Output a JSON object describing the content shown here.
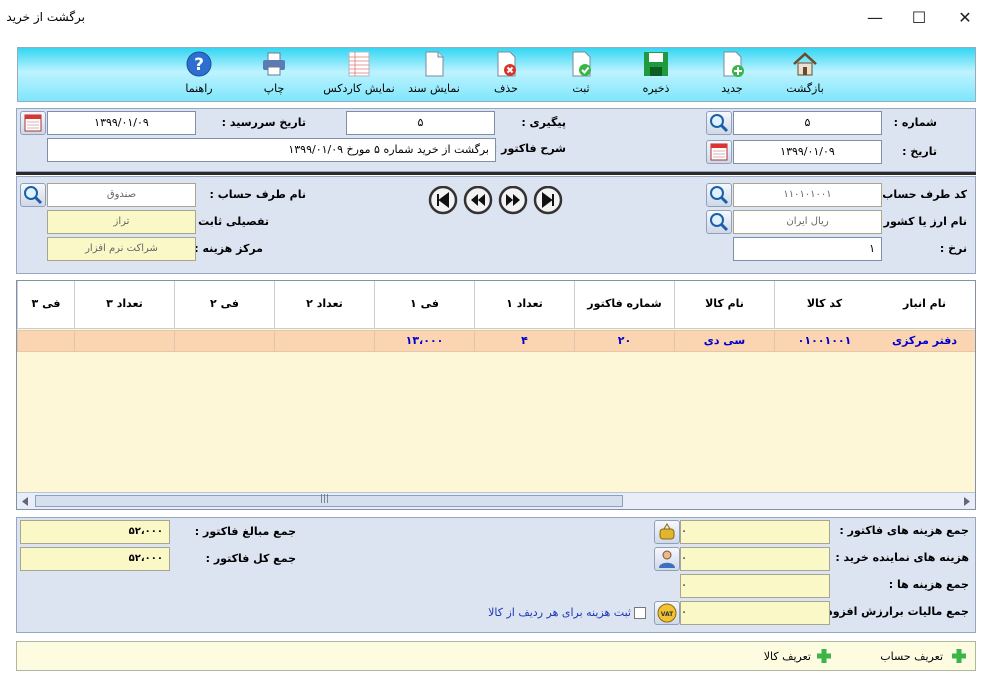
{
  "window": {
    "title": "برگشت از خرید",
    "minimize": "—",
    "maximize": "☐",
    "close": "✕"
  },
  "toolbar": {
    "back": "بازگشت",
    "new": "جدید",
    "save": "ذخیره",
    "register": "ثبت",
    "delete": "حذف",
    "show_document": "نمایش سند",
    "show_cardex": "نمایش کاردکس",
    "print": "چاپ",
    "help": "راهنما"
  },
  "header": {
    "number_label": "شماره :",
    "number_value": "۵",
    "date_label": "تاریخ :",
    "date_value": "۱۳۹۹/۰۱/۰۹",
    "followup_label": "پیگیری :",
    "followup_value": "۵",
    "due_date_label": "تاریخ سررسید :",
    "due_date_value": "۱۳۹۹/۰۱/۰۹",
    "invoice_desc_label": "شرح فاکتور :",
    "invoice_desc_value": "برگشت از خرید شماره ۵ مورخ ۱۳۹۹/۰۱/۰۹"
  },
  "account": {
    "account_code_label": "کد طرف حساب :",
    "account_code_value": "۱۱۰۱۰۱۰۰۱",
    "currency_label": "نام ارز یا کشور :",
    "currency_value": "ریال ایران",
    "rate_label": "نرخ :",
    "rate_value": "۱",
    "account_name_label": "نام طرف حساب :",
    "account_name_value": "صندوق",
    "detail_label": "تفصیلی ثابت :",
    "detail_value": "تراز",
    "cost_center_label": "مرکز هزینه :",
    "cost_center_value": "شراکت نرم افزار"
  },
  "grid": {
    "columns": [
      "نام انبار",
      "کد کالا",
      "نام کالا",
      "شماره فاکتور",
      "تعداد ۱",
      "فی ۱",
      "تعداد ۲",
      "فی ۲",
      "تعداد ۳",
      "فی ۳"
    ],
    "rows": [
      [
        "دفتر مرکزی",
        "۰۱۰۰۱۰۰۱",
        "سی دی",
        "۲۰",
        "۴",
        "۱۳،۰۰۰",
        "",
        "",
        "",
        ""
      ]
    ],
    "scroll_grip": "|||"
  },
  "summary": {
    "invoice_costs_label": "جمع هزینه های فاکتور :",
    "invoice_costs_value": "۰",
    "agent_costs_label": "هزینه های نماینده خرید :",
    "agent_costs_value": "۰",
    "total_costs_label": "جمع هزینه ها :",
    "total_costs_value": "۰",
    "vat_label": "جمع مالیات برارزش افزوده :",
    "vat_value": "۰",
    "per_row_cost_label": "ثبت هزینه برای هر ردیف از کالا",
    "invoice_amounts_label": "جمع مبالغ فاکتور :",
    "invoice_amounts_value": "۵۲،۰۰۰",
    "invoice_total_label": "جمع کل فاکتور :",
    "invoice_total_value": "۵۲،۰۰۰",
    "vat_badge": "VAT"
  },
  "footer": {
    "define_account": "تعریف حساب",
    "define_item": "تعریف کالا"
  },
  "colors": {
    "toolbar": "#7ee6fb",
    "panel": "#dde4f1",
    "grid_bg": "#fdf7d8",
    "row_highlight": "#fbd4b2",
    "cell_text": "#0000cc"
  }
}
